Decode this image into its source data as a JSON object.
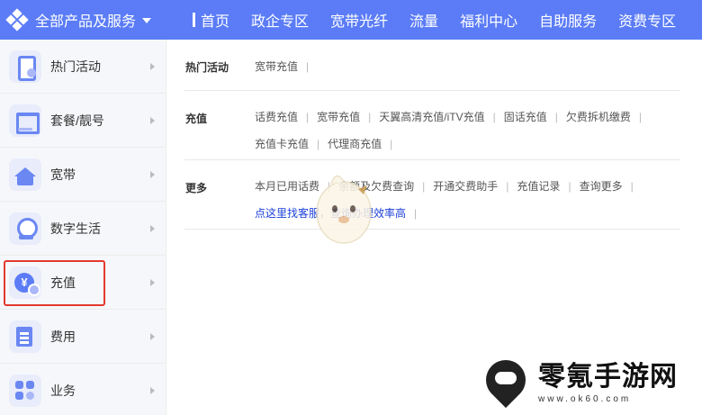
{
  "header": {
    "brand_title": "全部产品及服务",
    "nav": [
      "首页",
      "政企专区",
      "宽带光纤",
      "流量",
      "福利中心",
      "自助服务",
      "资费专区"
    ]
  },
  "sidebar": {
    "items": [
      {
        "label": "热门活动",
        "icon": "phone-activity-icon"
      },
      {
        "label": "套餐/靓号",
        "icon": "package-icon"
      },
      {
        "label": "宽带",
        "icon": "broadband-icon"
      },
      {
        "label": "数字生活",
        "icon": "digital-life-icon"
      },
      {
        "label": "充值",
        "icon": "recharge-icon"
      },
      {
        "label": "费用",
        "icon": "fee-icon"
      },
      {
        "label": "业务",
        "icon": "service-icon"
      }
    ],
    "highlighted": "充值",
    "highlight_color": "#e23a2e"
  },
  "content": {
    "sections": [
      {
        "title": "热门活动",
        "links": [
          "宽带充值"
        ]
      },
      {
        "title": "充值",
        "links": [
          "话费充值",
          "宽带充值",
          "天翼高清充值/iTV充值",
          "固话充值",
          "欠费拆机缴费",
          "充值卡充值",
          "代理商充值"
        ]
      },
      {
        "title": "更多",
        "links": [
          "本月已用话费",
          "余额及欠费查询",
          "开通交费助手",
          "充值记录",
          "查询更多",
          "点这里找客服，查询办理效率高"
        ]
      }
    ]
  },
  "watermark": {
    "title": "零氪手游网",
    "url": "www.ok60.com"
  },
  "colors": {
    "nav_bg": "#5b7cf6",
    "link_highlight": "#1a3fd8"
  }
}
